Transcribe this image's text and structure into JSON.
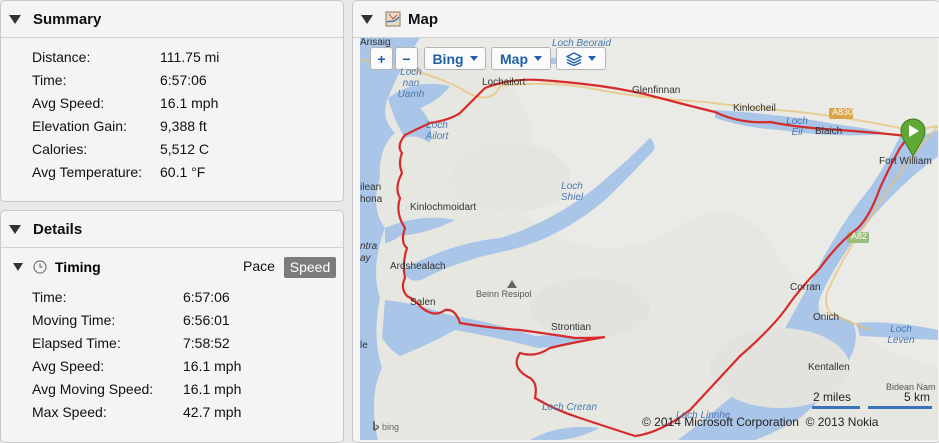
{
  "summary": {
    "title": "Summary",
    "rows": [
      {
        "label": "Distance:",
        "value": "111.75 mi"
      },
      {
        "label": "Time:",
        "value": "6:57:06"
      },
      {
        "label": "Avg Speed:",
        "value": "16.1 mph"
      },
      {
        "label": "Elevation Gain:",
        "value": "9,388 ft"
      },
      {
        "label": "Calories:",
        "value": "5,512 C"
      },
      {
        "label": "Avg Temperature:",
        "value": "60.1 °F"
      }
    ]
  },
  "details": {
    "title": "Details",
    "timing": {
      "title": "Timing",
      "toggle": {
        "pace": "Pace",
        "speed": "Speed"
      },
      "rows": [
        {
          "label": "Time:",
          "value": "6:57:06"
        },
        {
          "label": "Moving Time:",
          "value": "6:56:01"
        },
        {
          "label": "Elapsed Time:",
          "value": "7:58:52"
        },
        {
          "label": "Avg Speed:",
          "value": "16.1 mph"
        },
        {
          "label": "Avg Moving Speed:",
          "value": "16.1 mph"
        },
        {
          "label": "Max Speed:",
          "value": "42.7 mph"
        }
      ]
    }
  },
  "map": {
    "title": "Map",
    "zoom_in": "+",
    "zoom_out": "−",
    "provider": "Bing",
    "map_type": "Map",
    "place_labels": {
      "arisaig": "Arisaig",
      "lochailort": "Lochailort",
      "glenfinnan": "Glenfinnan",
      "kinlocheil": "Kinlocheil",
      "blaich": "Blaich",
      "fort_william": "Fort William",
      "kinlochmoidart": "Kinlochmoidart",
      "ardshealach": "Ardshealach",
      "salen": "Salen",
      "strontian": "Strontian",
      "corran": "Corran",
      "onich": "Onich",
      "kentallen": "Kentallen",
      "beinn_resipol": "Beinn Resipol",
      "bidean": "Bidean Nam",
      "ilean": "ilean",
      "hona": "hona",
      "ntra": "ntra",
      "ay": "ay",
      "le": "le"
    },
    "water_labels": {
      "loch_beoraid": "Loch Beoraid",
      "loch_nan_uamh": "Loch nan Uamh",
      "loch_ailort": "Loch Ailort",
      "loch_shiel": "Loch Shiel",
      "loch_eil": "Loch Eil",
      "loch_leven": "Loch Leven",
      "loch_linnhe": "Loch Linnhe",
      "loch_creran": "Loch Creran"
    },
    "road_labels": {
      "a830": "A830",
      "a82": "A82"
    },
    "scale": {
      "miles": "2 miles",
      "km": "5 km"
    },
    "copyright": "© 2014 Microsoft Corporation  © 2013 Nokia",
    "bing_logo": "bing",
    "colors": {
      "route": "#d62b2b",
      "water": "#a9c5e8",
      "marker": "#5fa833",
      "buttons": "#1f5fa8"
    }
  }
}
